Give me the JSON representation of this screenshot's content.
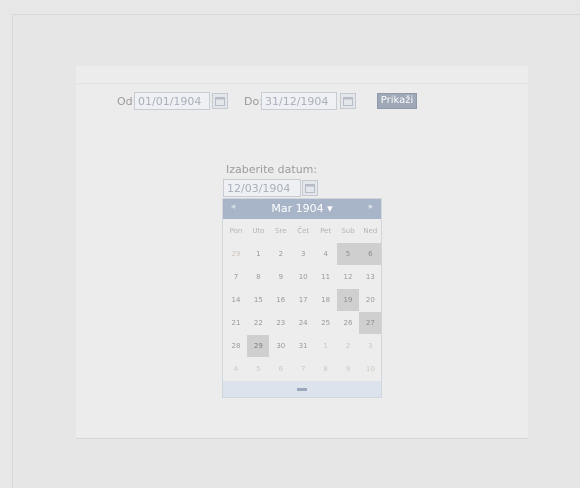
{
  "filters": {
    "from_label": "Od:",
    "from_value": "01/01/1904",
    "to_label": "Do:",
    "to_value": "31/12/1904",
    "show_label": "Prikaži"
  },
  "picker": {
    "label": "Izaberite datum:",
    "value": "12/03/1904",
    "month_title": "Mar 1904 ▾",
    "prev": "◂",
    "next": "▸",
    "weekdays": [
      "Pon",
      "Uto",
      "Sre",
      "Čet",
      "Pet",
      "Sub",
      "Ned"
    ],
    "weeks": [
      [
        "29",
        "1",
        "2",
        "3",
        "4",
        "5",
        "6"
      ],
      [
        "7",
        "8",
        "9",
        "10",
        "11",
        "12",
        "13"
      ],
      [
        "14",
        "15",
        "16",
        "17",
        "18",
        "19",
        "20"
      ],
      [
        "21",
        "22",
        "23",
        "24",
        "25",
        "26",
        "27"
      ],
      [
        "28",
        "29",
        "30",
        "31",
        "1",
        "2",
        "3"
      ],
      [
        "4",
        "5",
        "6",
        "7",
        "8",
        "9",
        "10"
      ]
    ]
  }
}
